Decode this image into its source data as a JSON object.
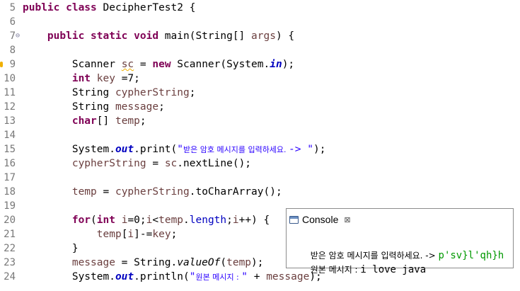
{
  "editor": {
    "lines": [
      {
        "n": "5",
        "tokens": [
          {
            "t": "public class ",
            "c": "kw"
          },
          {
            "t": "DecipherTest2 {",
            "c": ""
          }
        ]
      },
      {
        "n": "6",
        "tokens": []
      },
      {
        "n": "7",
        "fold": "⊖",
        "tokens": [
          {
            "t": "    ",
            "c": ""
          },
          {
            "t": "public static void ",
            "c": "kw"
          },
          {
            "t": "main(String[] ",
            "c": ""
          },
          {
            "t": "args",
            "c": "var"
          },
          {
            "t": ") {",
            "c": ""
          }
        ]
      },
      {
        "n": "8",
        "tokens": []
      },
      {
        "n": "9",
        "warn": true,
        "tokens": [
          {
            "t": "        Scanner ",
            "c": ""
          },
          {
            "t": "sc",
            "c": "var squig"
          },
          {
            "t": " = ",
            "c": ""
          },
          {
            "t": "new ",
            "c": "kw"
          },
          {
            "t": "Scanner(System.",
            "c": ""
          },
          {
            "t": "in",
            "c": "fld"
          },
          {
            "t": ");",
            "c": ""
          }
        ]
      },
      {
        "n": "10",
        "tokens": [
          {
            "t": "        ",
            "c": ""
          },
          {
            "t": "int ",
            "c": "kw"
          },
          {
            "t": "key",
            "c": "var"
          },
          {
            "t": " =7;",
            "c": ""
          }
        ]
      },
      {
        "n": "11",
        "tokens": [
          {
            "t": "        String ",
            "c": ""
          },
          {
            "t": "cypherString",
            "c": "var"
          },
          {
            "t": ";",
            "c": ""
          }
        ]
      },
      {
        "n": "12",
        "tokens": [
          {
            "t": "        String ",
            "c": ""
          },
          {
            "t": "message",
            "c": "var"
          },
          {
            "t": ";",
            "c": ""
          }
        ]
      },
      {
        "n": "13",
        "tokens": [
          {
            "t": "        ",
            "c": ""
          },
          {
            "t": "char",
            "c": "kw"
          },
          {
            "t": "[] ",
            "c": ""
          },
          {
            "t": "temp",
            "c": "var"
          },
          {
            "t": ";",
            "c": ""
          }
        ]
      },
      {
        "n": "14",
        "tokens": []
      },
      {
        "n": "15",
        "tokens": [
          {
            "t": "        System.",
            "c": ""
          },
          {
            "t": "out",
            "c": "fld"
          },
          {
            "t": ".print(",
            "c": ""
          },
          {
            "t": "\"",
            "c": "str"
          },
          {
            "t": "받은 암호 메시지를 입력하세요. ",
            "c": "str kor"
          },
          {
            "t": "-> \"",
            "c": "str"
          },
          {
            "t": ");",
            "c": ""
          }
        ]
      },
      {
        "n": "16",
        "tokens": [
          {
            "t": "        ",
            "c": ""
          },
          {
            "t": "cypherString",
            "c": "var"
          },
          {
            "t": " = ",
            "c": ""
          },
          {
            "t": "sc",
            "c": "var"
          },
          {
            "t": ".nextLine();",
            "c": ""
          }
        ]
      },
      {
        "n": "17",
        "tokens": []
      },
      {
        "n": "18",
        "tokens": [
          {
            "t": "        ",
            "c": ""
          },
          {
            "t": "temp",
            "c": "var"
          },
          {
            "t": " = ",
            "c": ""
          },
          {
            "t": "cypherString",
            "c": "var"
          },
          {
            "t": ".toCharArray();",
            "c": ""
          }
        ]
      },
      {
        "n": "19",
        "tokens": []
      },
      {
        "n": "20",
        "tokens": [
          {
            "t": "        ",
            "c": ""
          },
          {
            "t": "for",
            "c": "kw"
          },
          {
            "t": "(",
            "c": ""
          },
          {
            "t": "int ",
            "c": "kw"
          },
          {
            "t": "i",
            "c": "var"
          },
          {
            "t": "=0;",
            "c": ""
          },
          {
            "t": "i",
            "c": "var"
          },
          {
            "t": "<",
            "c": ""
          },
          {
            "t": "temp",
            "c": "var"
          },
          {
            "t": ".",
            "c": ""
          },
          {
            "t": "length",
            "c": "fldp"
          },
          {
            "t": ";",
            "c": ""
          },
          {
            "t": "i",
            "c": "var"
          },
          {
            "t": "++) {",
            "c": ""
          }
        ]
      },
      {
        "n": "21",
        "tokens": [
          {
            "t": "            ",
            "c": ""
          },
          {
            "t": "temp",
            "c": "var"
          },
          {
            "t": "[",
            "c": ""
          },
          {
            "t": "i",
            "c": "var"
          },
          {
            "t": "]-=",
            "c": ""
          },
          {
            "t": "key",
            "c": "var"
          },
          {
            "t": ";",
            "c": ""
          }
        ]
      },
      {
        "n": "22",
        "tokens": [
          {
            "t": "        }",
            "c": ""
          }
        ]
      },
      {
        "n": "23",
        "tokens": [
          {
            "t": "        ",
            "c": ""
          },
          {
            "t": "message",
            "c": "var"
          },
          {
            "t": " = String.",
            "c": ""
          },
          {
            "t": "valueOf",
            "c": "ital"
          },
          {
            "t": "(",
            "c": ""
          },
          {
            "t": "temp",
            "c": "var"
          },
          {
            "t": ");",
            "c": ""
          }
        ]
      },
      {
        "n": "24",
        "tokens": [
          {
            "t": "        System.",
            "c": ""
          },
          {
            "t": "out",
            "c": "fld"
          },
          {
            "t": ".println(",
            "c": ""
          },
          {
            "t": "\"",
            "c": "str"
          },
          {
            "t": "원본 메시지 : ",
            "c": "str kor"
          },
          {
            "t": "\"",
            "c": "str"
          },
          {
            "t": " + ",
            "c": ""
          },
          {
            "t": "message",
            "c": "var"
          },
          {
            "t": ");",
            "c": ""
          }
        ]
      }
    ]
  },
  "console": {
    "tab_label": "Console",
    "close_icon": "close-icon",
    "prompt": "받은 암호 메시지를 입력하세요. -> ",
    "user_input": "p'sv}l'qh}h",
    "result_label": "원본 메시지 : ",
    "result_value": "i love java"
  }
}
